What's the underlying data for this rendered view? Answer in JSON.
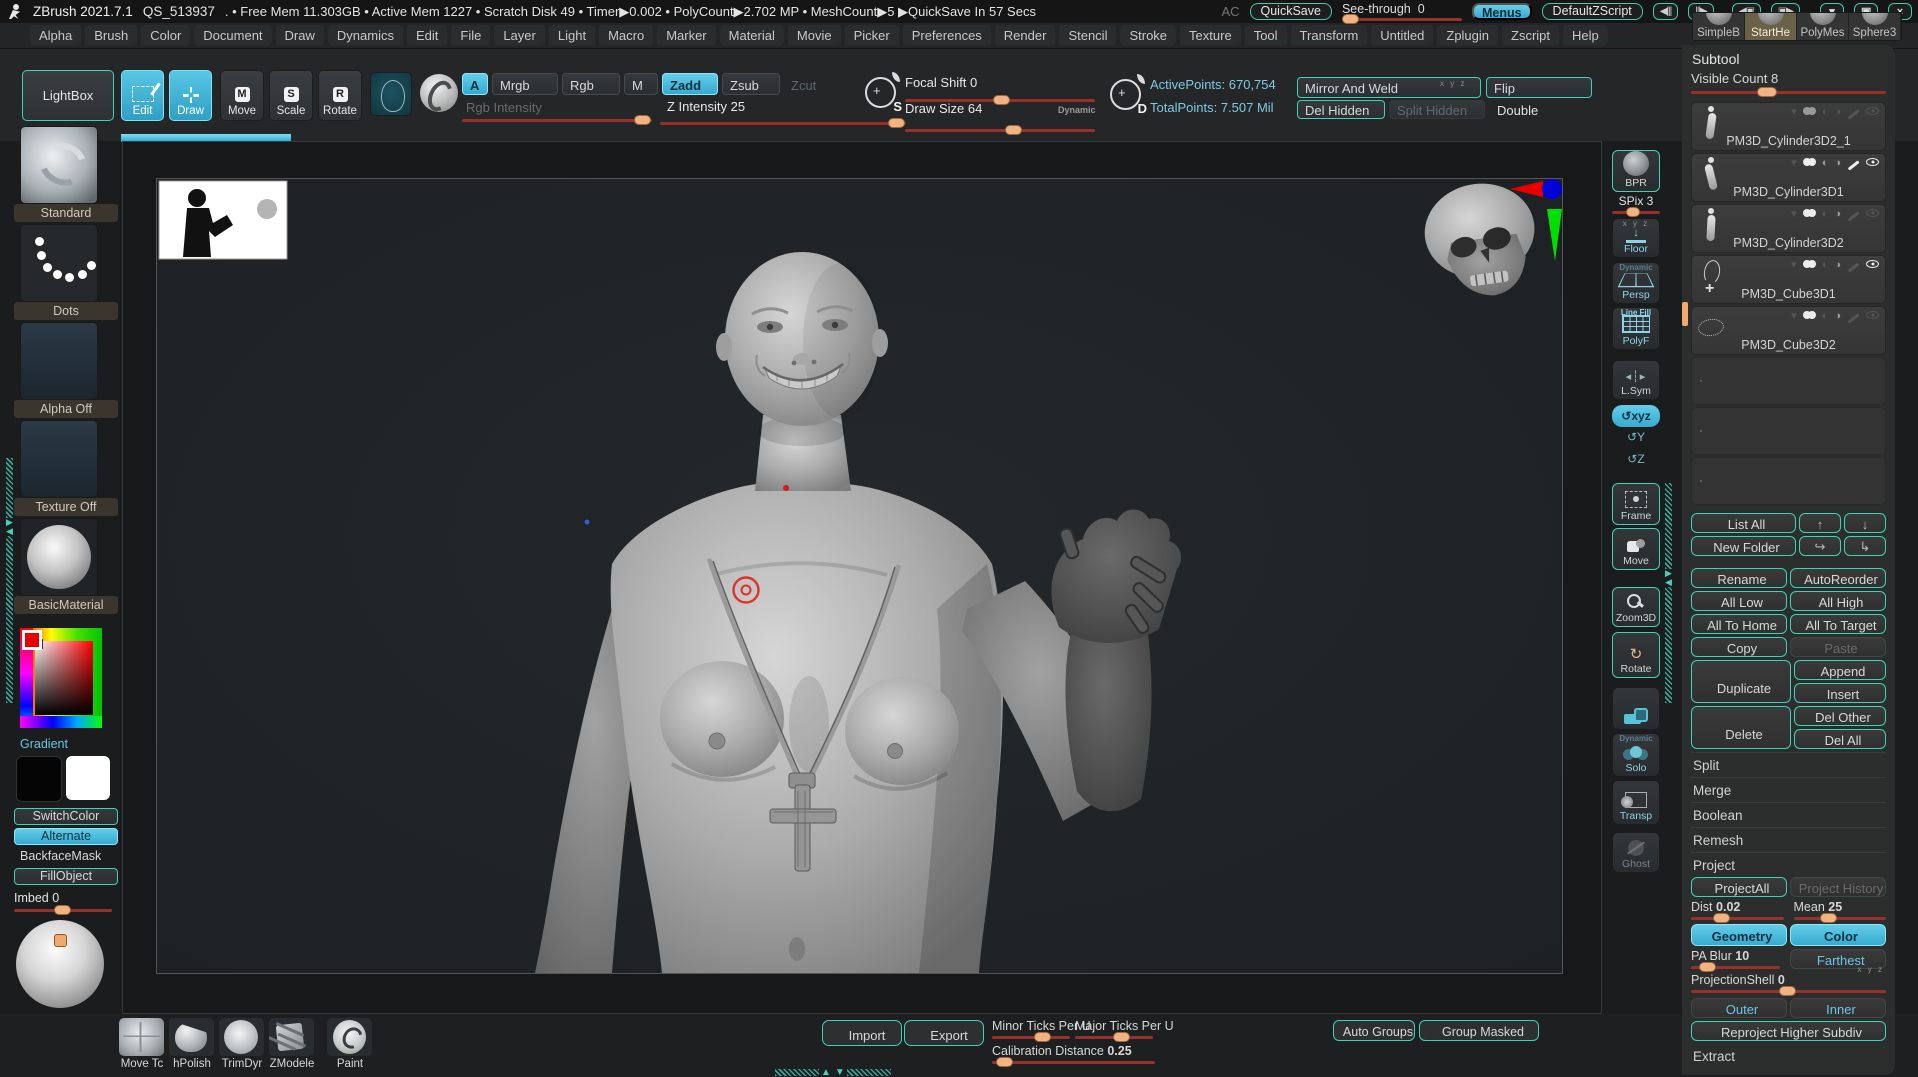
{
  "titlebar": {
    "app_title": "ZBrush 2021.7.1",
    "session": "QS_513937",
    "stats": ". • Free Mem 11.303GB • Active Mem 1227 • Scratch Disk 49 •  Timer▶0.002 • PolyCount▶2.702 MP  • MeshCount▶5   ▶QuickSave In 57 Secs",
    "ac": "AC",
    "quicksave": "QuickSave",
    "see_through_label": "See-through",
    "see_through_value": "0",
    "menus": "Menus",
    "default_zscript": "DefaultZScript"
  },
  "icons": {
    "scroll_left_glyph": "◀|||",
    "scroll_right_glyph": "|||▶",
    "tray_left_glyph": "◀▣",
    "tray_right_glyph": "▣▶",
    "minimize_glyph": "▾",
    "restore_glyph": "▣",
    "close_glyph": "×",
    "up_arrow": "↑",
    "down_arrow": "↓",
    "redo_arrow": "↪",
    "insert_arrow": "↳",
    "subtool_row_arrow": "▾",
    "half_circle": "◐",
    "diff_circle": "◑"
  },
  "menubar": {
    "items": [
      "Alpha",
      "Brush",
      "Color",
      "Document",
      "Draw",
      "Dynamics",
      "Edit",
      "File",
      "Layer",
      "Light",
      "Macro",
      "Marker",
      "Material",
      "Movie",
      "Picker",
      "Preferences",
      "Render",
      "Stencil",
      "Stroke",
      "Texture",
      "Tool",
      "Transform",
      "Untitled",
      "Zplugin",
      "Zscript",
      "Help"
    ]
  },
  "tool_popup": {
    "items": [
      {
        "label": "SimpleB",
        "state": ""
      },
      {
        "label": "StartHe",
        "state": "active"
      },
      {
        "label": "PolyMes",
        "state": ""
      },
      {
        "label": "Sphere3",
        "state": ""
      }
    ]
  },
  "topshelf": {
    "zsub": "Z Sub",
    "lightbox": "LightBox",
    "edit": "Edit",
    "draw": "Draw",
    "move": "Move",
    "scale": "Scale",
    "rotate": "Rotate",
    "move_letter": "M",
    "scale_letter": "S",
    "rotate_letter": "R",
    "a": "A",
    "mrgb": "Mrgb",
    "rgb": "Rgb",
    "m": "M",
    "rgb_intensity": "Rgb Intensity",
    "zadd": "Zadd",
    "zsub_btn": "Zsub",
    "zcut": "Zcut",
    "z_intensity_label": "Z Intensity",
    "z_intensity_value": "25",
    "sculptris_letter": "S",
    "dynamic_letter": "D",
    "focal_shift_label": "Focal Shift",
    "focal_shift_value": "0",
    "draw_size_label": "Draw Size",
    "draw_size_value": "64",
    "dynamic_tag": "Dynamic",
    "active_points": "ActivePoints: 670,754",
    "total_points": "TotalPoints: 7.507 Mil",
    "mirror_and_weld": "Mirror And Weld",
    "flip": "Flip",
    "del_hidden": "Del Hidden",
    "split_hidden": "Split Hidden",
    "double": "Double",
    "xyz_micro": "x y z"
  },
  "leftshelf": {
    "items": [
      {
        "label": "Standard",
        "type": "t-brush"
      },
      {
        "label": "Dots",
        "type": "t-dots"
      },
      {
        "label": "Alpha Off",
        "type": "t-alpha"
      },
      {
        "label": "Texture Off",
        "type": "t-texture"
      },
      {
        "label": "BasicMaterial",
        "type": "t-material"
      }
    ],
    "gradient": "Gradient",
    "switch_color": "SwitchColor",
    "alternate": "Alternate",
    "backface_mask": "BackfaceMask",
    "fill_object": "FillObject",
    "imbed_label": "Imbed",
    "imbed_value": "0"
  },
  "rightshelf": {
    "bpr": "BPR",
    "spix_label": "SPix",
    "spix_value": "3",
    "floor": "Floor",
    "persp": "Persp",
    "persp_tag": "Dynamic",
    "polyf": "PolyF",
    "polyf_tag": "Line Fill",
    "lsym": "L.Sym",
    "xyz": "xyz",
    "rot_y": "↺Y",
    "rot_z": "↺Z",
    "frame": "Frame",
    "move": "Move",
    "zoom3d": "Zoom3D",
    "rotate": "Rotate",
    "solo": "Solo",
    "solo_tag": "Dynamic",
    "transp": "Transp",
    "ghost": "Ghost",
    "floor_micro": "x y z"
  },
  "subtool": {
    "title": "Subtool",
    "visible_count_label": "Visible Count",
    "visible_count_value": "8",
    "items": [
      {
        "name": "PM3D_Cylinder3D2_1",
        "thumb": "th-figure",
        "arrow": "s-dim",
        "paint": "s-mid",
        "half": "s-dim",
        "diff": "s-dim",
        "brush": "s-dim",
        "eye": "s-dim"
      },
      {
        "name": "PM3D_Cylinder3D1",
        "thumb": "th-figure2",
        "arrow": "s-dim",
        "paint": "s-on",
        "half": "s-mid",
        "diff": "s-mid",
        "brush": "s-on",
        "eye": "s-on"
      },
      {
        "name": "PM3D_Cylinder3D2",
        "thumb": "th-figure3",
        "arrow": "s-dim",
        "paint": "s-on",
        "half": "s-dim",
        "diff": "s-mid",
        "brush": "s-dim",
        "eye": "s-dim"
      },
      {
        "name": "PM3D_Cube3D1",
        "thumb": "th-pendant",
        "arrow": "s-dim",
        "paint": "s-on",
        "half": "s-dim",
        "diff": "s-mid",
        "brush": "s-dim",
        "eye": "s-on"
      },
      {
        "name": "PM3D_Cube3D2",
        "thumb": "th-loop",
        "arrow": "s-dim",
        "paint": "s-on",
        "half": "s-dim",
        "diff": "s-mid",
        "brush": "s-dim",
        "eye": "s-dim"
      }
    ],
    "list_all": "List All",
    "new_folder": "New Folder",
    "rename": "Rename",
    "autoreorder": "AutoReorder",
    "all_low": "All Low",
    "all_high": "All High",
    "all_to_home": "All To Home",
    "all_to_target": "All To Target",
    "copy": "Copy",
    "paste": "Paste",
    "duplicate": "Duplicate",
    "append": "Append",
    "insert": "Insert",
    "delete": "Delete",
    "del_other": "Del Other",
    "del_all": "Del All",
    "split": "Split",
    "merge": "Merge",
    "boolean": "Boolean",
    "remesh": "Remesh",
    "project": "Project",
    "project_all": "ProjectAll",
    "project_history": "Project History",
    "dist_label": "Dist",
    "dist_value": "0.02",
    "mean_label": "Mean",
    "mean_value": "25",
    "geometry": "Geometry",
    "color": "Color",
    "pa_blur_label": "PA Blur",
    "pa_blur_value": "10",
    "farthest": "Farthest",
    "projection_shell_label": "ProjectionShell",
    "projection_shell_value": "0",
    "outer": "Outer",
    "inner": "Inner",
    "reproject": "Reproject Higher Subdiv",
    "extract": "Extract",
    "xyz_micro": "x y z"
  },
  "bottomshelf": {
    "brushes": [
      {
        "label": "Move Tc",
        "type": "b-movetopo"
      },
      {
        "label": "hPolish",
        "type": "b-hpolish"
      },
      {
        "label": "TrimDyr",
        "type": "b-trimdyn"
      },
      {
        "label": "ZModele",
        "type": "b-zmodeler"
      },
      {
        "label": "Paint",
        "type": "b-paint"
      }
    ],
    "import": "Import",
    "export": "Export",
    "minor_ticks": "Minor Ticks Per U",
    "major_ticks": "Major Ticks Per U",
    "calibration_label": "Calibration Distance",
    "calibration_value": "0.25",
    "auto_groups": "Auto Groups",
    "group_masked": "Group Masked"
  },
  "colors": {
    "accent_teal": "#3ed2b6",
    "accent_cyan": "#45b8da",
    "cyan_text": "#6cc5e4",
    "slider_track": "#97312a",
    "slider_handle": "#f2b383",
    "shelf_label_bg": "#3b362d",
    "panel_bg": "#2c2d2d"
  }
}
